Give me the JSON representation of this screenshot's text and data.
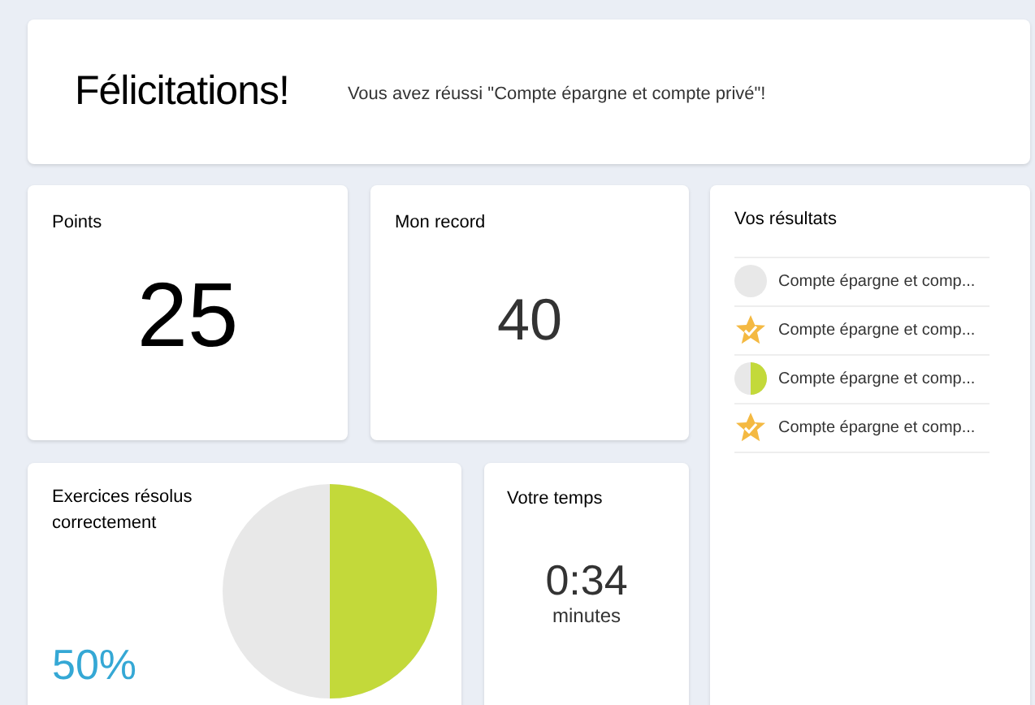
{
  "header": {
    "title": "Félicitations!",
    "message": "Vous avez réussi \"Compte épargne et compte privé\"!"
  },
  "points": {
    "label": "Points",
    "value": "25"
  },
  "record": {
    "label": "Mon record",
    "value": "40"
  },
  "exercises": {
    "label": "Exercices résolus correctement",
    "percent": "50%",
    "level": 0.5
  },
  "time": {
    "label": "Votre temps",
    "value": "0:34",
    "unit": "minutes"
  },
  "results": {
    "title": "Vos résultats",
    "items": [
      {
        "kind": "empty",
        "label": "Compte épargne et comp..."
      },
      {
        "kind": "star",
        "label": "Compte épargne et comp..."
      },
      {
        "kind": "half",
        "label": "Compte épargne et comp..."
      },
      {
        "kind": "star",
        "label": "Compte épargne et comp..."
      }
    ]
  }
}
